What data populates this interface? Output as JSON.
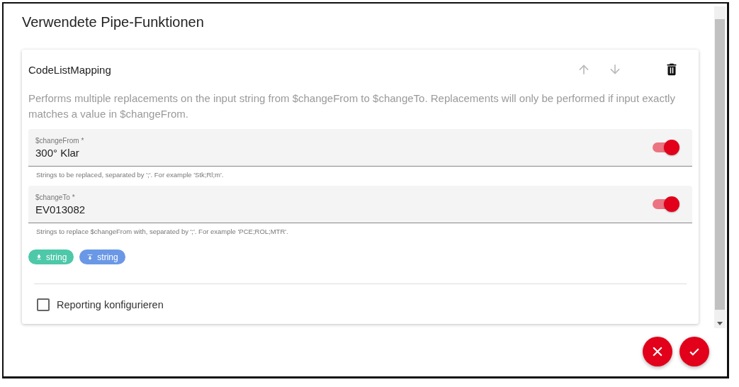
{
  "dialog": {
    "title": "Verwendete Pipe-Funktionen"
  },
  "function": {
    "name": "CodeListMapping",
    "move_up": {
      "disabled": true
    },
    "move_down": {
      "disabled": true
    },
    "description": "Performs multiple replacements on the input string from $changeFrom to $changeTo. Replacements will only be performed if input exactly matches a value in $changeFrom.",
    "fields": [
      {
        "label": "$changeFrom *",
        "value": "300° Klar",
        "on": true,
        "hint": "Strings to be replaced, separated by ';'. For example 'Stk;Rl;m'."
      },
      {
        "label": "$changeTo *",
        "value": "EV013082",
        "on": true,
        "hint": "Strings to replace $changeFrom with, separated by ';'. For example 'PCE;ROL;MTR'."
      }
    ],
    "types": [
      {
        "kind": "input",
        "label": "string",
        "color": "#4dc8a8"
      },
      {
        "kind": "output",
        "label": "string",
        "color": "#6a98e6"
      }
    ],
    "reporting": {
      "label": "Reporting konfigurieren",
      "checked": false
    }
  }
}
